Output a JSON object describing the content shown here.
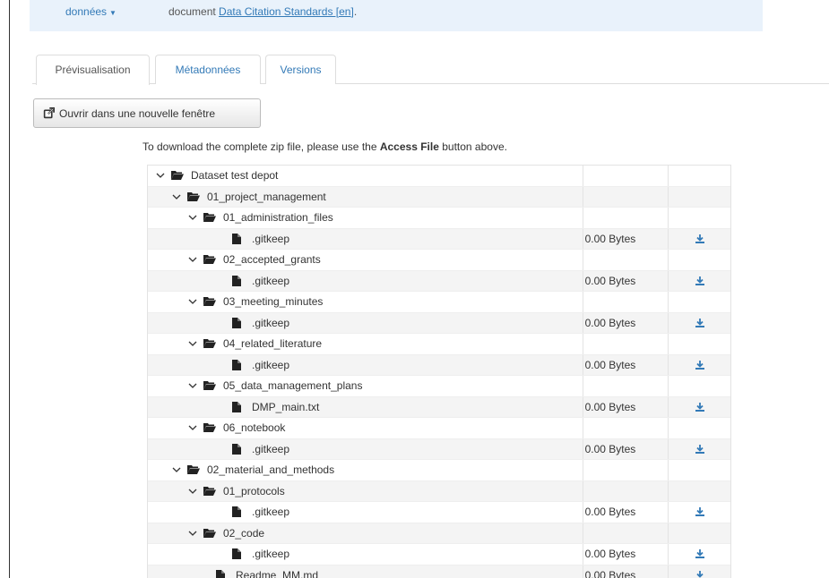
{
  "banner": {
    "menu_label": "données",
    "text_prefix": "document",
    "link_text": "Data Citation Standards [en]",
    "text_suffix": "."
  },
  "tabs": [
    {
      "label": "Prévisualisation",
      "active": true
    },
    {
      "label": "Métadonnées",
      "active": false
    },
    {
      "label": "Versions",
      "active": false
    }
  ],
  "open_button": {
    "label": "Ouvrir dans une nouvelle fenêtre"
  },
  "download_note": {
    "prefix": "To download the complete zip file, please use the ",
    "bold": "Access File",
    "suffix": " button above."
  },
  "colors": {
    "accent": "#337ab7",
    "banner_bg": "#e9f2fb"
  },
  "tree": [
    {
      "name": "Dataset test depot",
      "type": "folder",
      "level": 0
    },
    {
      "name": "01_project_management",
      "type": "folder",
      "level": 1
    },
    {
      "name": "01_administration_files",
      "type": "folder",
      "level": 2
    },
    {
      "name": ".gitkeep",
      "type": "file",
      "level": 3,
      "size": "0.00 Bytes"
    },
    {
      "name": "02_accepted_grants",
      "type": "folder",
      "level": 2
    },
    {
      "name": ".gitkeep",
      "type": "file",
      "level": 3,
      "size": "0.00 Bytes"
    },
    {
      "name": "03_meeting_minutes",
      "type": "folder",
      "level": 2
    },
    {
      "name": ".gitkeep",
      "type": "file",
      "level": 3,
      "size": "0.00 Bytes"
    },
    {
      "name": "04_related_literature",
      "type": "folder",
      "level": 2
    },
    {
      "name": ".gitkeep",
      "type": "file",
      "level": 3,
      "size": "0.00 Bytes"
    },
    {
      "name": "05_data_management_plans",
      "type": "folder",
      "level": 2
    },
    {
      "name": "DMP_main.txt",
      "type": "file",
      "level": 3,
      "size": "0.00 Bytes"
    },
    {
      "name": "06_notebook",
      "type": "folder",
      "level": 2
    },
    {
      "name": ".gitkeep",
      "type": "file",
      "level": 3,
      "size": "0.00 Bytes"
    },
    {
      "name": "02_material_and_methods",
      "type": "folder",
      "level": 1
    },
    {
      "name": "01_protocols",
      "type": "folder",
      "level": 2
    },
    {
      "name": ".gitkeep",
      "type": "file",
      "level": 3,
      "size": "0.00 Bytes"
    },
    {
      "name": "02_code",
      "type": "folder",
      "level": 2
    },
    {
      "name": ".gitkeep",
      "type": "file",
      "level": 3,
      "size": "0.00 Bytes"
    },
    {
      "name": "Readme_MM.md",
      "type": "file",
      "level": 2,
      "size": "0.00 Bytes"
    }
  ]
}
